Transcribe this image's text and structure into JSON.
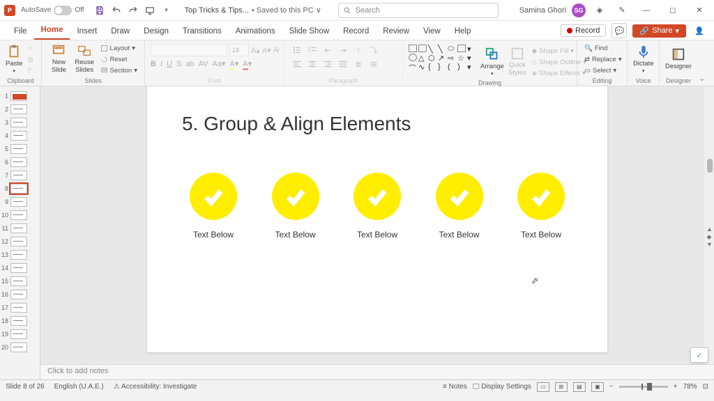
{
  "titleBar": {
    "autoSave": "AutoSave",
    "autoSaveState": "Off",
    "docTitle": "Top Tricks & Tips...",
    "docStatus": "• Saved to this PC ∨",
    "searchPlaceholder": "Search",
    "userName": "Samina Ghori",
    "userInitials": "SG"
  },
  "tabs": [
    "File",
    "Home",
    "Insert",
    "Draw",
    "Design",
    "Transitions",
    "Animations",
    "Slide Show",
    "Record",
    "Review",
    "View",
    "Help"
  ],
  "activeTab": "Home",
  "menuRight": {
    "record": "Record",
    "share": "Share"
  },
  "ribbon": {
    "clipboard": {
      "paste": "Paste",
      "label": "Clipboard"
    },
    "slides": {
      "new": "New\nSlide",
      "reuse": "Reuse\nSlides",
      "layout": "Layout",
      "reset": "Reset",
      "section": "Section",
      "label": "Slides"
    },
    "font": {
      "size": "18",
      "label": "Font"
    },
    "paragraph": {
      "label": "Paragraph"
    },
    "drawing": {
      "arrange": "Arrange",
      "quick": "Quick\nStyles",
      "fill": "Shape Fill",
      "outline": "Shape Outline",
      "effects": "Shape Effects",
      "label": "Drawing"
    },
    "editing": {
      "find": "Find",
      "replace": "Replace",
      "select": "Select",
      "label": "Editing"
    },
    "voice": {
      "dictate": "Dictate",
      "label": "Voice"
    },
    "designer": {
      "designer": "Designer",
      "label": "Designer"
    }
  },
  "thumbs": {
    "count": 20,
    "selected": 8,
    "redSlide": 1
  },
  "slide": {
    "title": "5. Group & Align Elements",
    "caption": "Text Below",
    "items": 5
  },
  "notesPlaceholder": "Click to add notes",
  "status": {
    "slideInfo": "Slide 8 of 26",
    "language": "English (U.A.E.)",
    "accessibility": "Accessibility: Investigate",
    "notes": "Notes",
    "display": "Display Settings",
    "zoom": "78%"
  }
}
